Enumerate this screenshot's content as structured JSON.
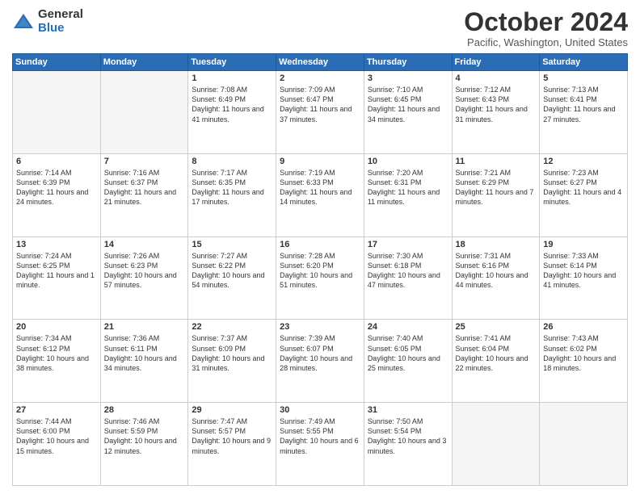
{
  "logo": {
    "general": "General",
    "blue": "Blue"
  },
  "header": {
    "month": "October 2024",
    "location": "Pacific, Washington, United States"
  },
  "weekdays": [
    "Sunday",
    "Monday",
    "Tuesday",
    "Wednesday",
    "Thursday",
    "Friday",
    "Saturday"
  ],
  "weeks": [
    [
      {
        "day": "",
        "empty": true
      },
      {
        "day": "",
        "empty": true
      },
      {
        "day": "1",
        "line1": "Sunrise: 7:08 AM",
        "line2": "Sunset: 6:49 PM",
        "line3": "Daylight: 11 hours and 41 minutes."
      },
      {
        "day": "2",
        "line1": "Sunrise: 7:09 AM",
        "line2": "Sunset: 6:47 PM",
        "line3": "Daylight: 11 hours and 37 minutes."
      },
      {
        "day": "3",
        "line1": "Sunrise: 7:10 AM",
        "line2": "Sunset: 6:45 PM",
        "line3": "Daylight: 11 hours and 34 minutes."
      },
      {
        "day": "4",
        "line1": "Sunrise: 7:12 AM",
        "line2": "Sunset: 6:43 PM",
        "line3": "Daylight: 11 hours and 31 minutes."
      },
      {
        "day": "5",
        "line1": "Sunrise: 7:13 AM",
        "line2": "Sunset: 6:41 PM",
        "line3": "Daylight: 11 hours and 27 minutes."
      }
    ],
    [
      {
        "day": "6",
        "line1": "Sunrise: 7:14 AM",
        "line2": "Sunset: 6:39 PM",
        "line3": "Daylight: 11 hours and 24 minutes."
      },
      {
        "day": "7",
        "line1": "Sunrise: 7:16 AM",
        "line2": "Sunset: 6:37 PM",
        "line3": "Daylight: 11 hours and 21 minutes."
      },
      {
        "day": "8",
        "line1": "Sunrise: 7:17 AM",
        "line2": "Sunset: 6:35 PM",
        "line3": "Daylight: 11 hours and 17 minutes."
      },
      {
        "day": "9",
        "line1": "Sunrise: 7:19 AM",
        "line2": "Sunset: 6:33 PM",
        "line3": "Daylight: 11 hours and 14 minutes."
      },
      {
        "day": "10",
        "line1": "Sunrise: 7:20 AM",
        "line2": "Sunset: 6:31 PM",
        "line3": "Daylight: 11 hours and 11 minutes."
      },
      {
        "day": "11",
        "line1": "Sunrise: 7:21 AM",
        "line2": "Sunset: 6:29 PM",
        "line3": "Daylight: 11 hours and 7 minutes."
      },
      {
        "day": "12",
        "line1": "Sunrise: 7:23 AM",
        "line2": "Sunset: 6:27 PM",
        "line3": "Daylight: 11 hours and 4 minutes."
      }
    ],
    [
      {
        "day": "13",
        "line1": "Sunrise: 7:24 AM",
        "line2": "Sunset: 6:25 PM",
        "line3": "Daylight: 11 hours and 1 minute."
      },
      {
        "day": "14",
        "line1": "Sunrise: 7:26 AM",
        "line2": "Sunset: 6:23 PM",
        "line3": "Daylight: 10 hours and 57 minutes."
      },
      {
        "day": "15",
        "line1": "Sunrise: 7:27 AM",
        "line2": "Sunset: 6:22 PM",
        "line3": "Daylight: 10 hours and 54 minutes."
      },
      {
        "day": "16",
        "line1": "Sunrise: 7:28 AM",
        "line2": "Sunset: 6:20 PM",
        "line3": "Daylight: 10 hours and 51 minutes."
      },
      {
        "day": "17",
        "line1": "Sunrise: 7:30 AM",
        "line2": "Sunset: 6:18 PM",
        "line3": "Daylight: 10 hours and 47 minutes."
      },
      {
        "day": "18",
        "line1": "Sunrise: 7:31 AM",
        "line2": "Sunset: 6:16 PM",
        "line3": "Daylight: 10 hours and 44 minutes."
      },
      {
        "day": "19",
        "line1": "Sunrise: 7:33 AM",
        "line2": "Sunset: 6:14 PM",
        "line3": "Daylight: 10 hours and 41 minutes."
      }
    ],
    [
      {
        "day": "20",
        "line1": "Sunrise: 7:34 AM",
        "line2": "Sunset: 6:12 PM",
        "line3": "Daylight: 10 hours and 38 minutes."
      },
      {
        "day": "21",
        "line1": "Sunrise: 7:36 AM",
        "line2": "Sunset: 6:11 PM",
        "line3": "Daylight: 10 hours and 34 minutes."
      },
      {
        "day": "22",
        "line1": "Sunrise: 7:37 AM",
        "line2": "Sunset: 6:09 PM",
        "line3": "Daylight: 10 hours and 31 minutes."
      },
      {
        "day": "23",
        "line1": "Sunrise: 7:39 AM",
        "line2": "Sunset: 6:07 PM",
        "line3": "Daylight: 10 hours and 28 minutes."
      },
      {
        "day": "24",
        "line1": "Sunrise: 7:40 AM",
        "line2": "Sunset: 6:05 PM",
        "line3": "Daylight: 10 hours and 25 minutes."
      },
      {
        "day": "25",
        "line1": "Sunrise: 7:41 AM",
        "line2": "Sunset: 6:04 PM",
        "line3": "Daylight: 10 hours and 22 minutes."
      },
      {
        "day": "26",
        "line1": "Sunrise: 7:43 AM",
        "line2": "Sunset: 6:02 PM",
        "line3": "Daylight: 10 hours and 18 minutes."
      }
    ],
    [
      {
        "day": "27",
        "line1": "Sunrise: 7:44 AM",
        "line2": "Sunset: 6:00 PM",
        "line3": "Daylight: 10 hours and 15 minutes."
      },
      {
        "day": "28",
        "line1": "Sunrise: 7:46 AM",
        "line2": "Sunset: 5:59 PM",
        "line3": "Daylight: 10 hours and 12 minutes."
      },
      {
        "day": "29",
        "line1": "Sunrise: 7:47 AM",
        "line2": "Sunset: 5:57 PM",
        "line3": "Daylight: 10 hours and 9 minutes."
      },
      {
        "day": "30",
        "line1": "Sunrise: 7:49 AM",
        "line2": "Sunset: 5:55 PM",
        "line3": "Daylight: 10 hours and 6 minutes."
      },
      {
        "day": "31",
        "line1": "Sunrise: 7:50 AM",
        "line2": "Sunset: 5:54 PM",
        "line3": "Daylight: 10 hours and 3 minutes."
      },
      {
        "day": "",
        "empty": true
      },
      {
        "day": "",
        "empty": true
      }
    ]
  ]
}
